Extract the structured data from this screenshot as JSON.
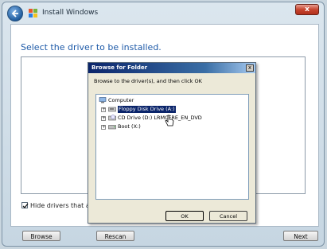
{
  "window": {
    "title": "Install Windows",
    "close_label": "x"
  },
  "main": {
    "heading": "Select the driver to be installed.",
    "hide_drivers_label": "Hide drivers that a",
    "hide_drivers_accel": "H",
    "hide_drivers_checked": true
  },
  "footer": {
    "browse_label": "Browse",
    "rescan_label": "Rescan",
    "next_label": "Next"
  },
  "dialog": {
    "title": "Browse for Folder",
    "close_label": "x",
    "prompt": "Browse to the driver(s), and then click OK",
    "tree": {
      "root": "Computer",
      "items": [
        {
          "label": "Floppy Disk Drive (A:)",
          "selected": true
        },
        {
          "label": "CD Drive (D:) LRMCFRE_EN_DVD",
          "selected": false
        },
        {
          "label": "Boot (X:)",
          "selected": false
        }
      ]
    },
    "ok_label": "OK",
    "cancel_label": "Cancel"
  },
  "colors": {
    "heading": "#1e5aa8",
    "selection": "#0a246a",
    "dialog_bg": "#ece9d8"
  }
}
